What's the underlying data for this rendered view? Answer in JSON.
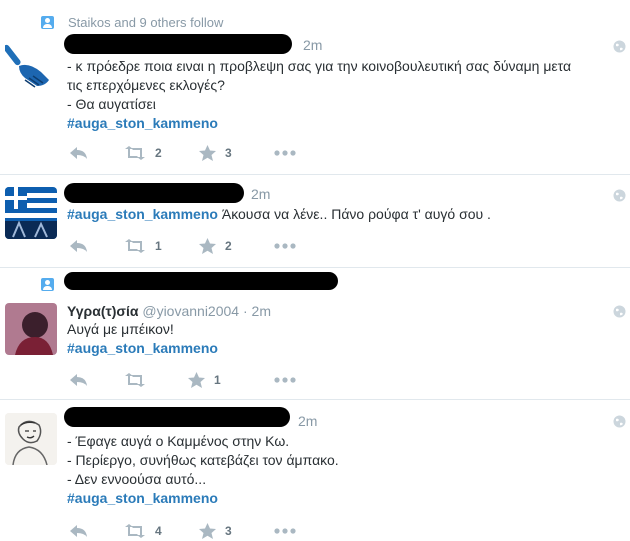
{
  "tweets": [
    {
      "context": "Staikos and 9 others follow",
      "time": "2m",
      "lines": [
        "- κ πρόεδρε ποια ειναι η προβλεψη σας για την κοινοβουλευτική σας δύναμη μετα",
        "τις επερχόμενες εκλογές?",
        "- Θα αυγατίσει"
      ],
      "hashtag": "#auga_ston_kammeno",
      "retweets": "2",
      "favorites": "3",
      "avatar_icon": "brush-icon"
    },
    {
      "time": "2m",
      "hashtag": "#auga_ston_kammeno",
      "after_hashtag": " Άκουσα να λένε.. Πάνο ρούφα τ' αυγό σου .",
      "retweets": "1",
      "favorites": "2",
      "avatar_icon": "greek-flag-icon"
    },
    {
      "fullname": "Υγρα(τ)σία",
      "handle": "@yiovanni2004",
      "sep": " · ",
      "time": "2m",
      "lines": [
        "Αυγά με μπέικον!"
      ],
      "hashtag": "#auga_ston_kammeno",
      "retweets": "",
      "favorites": "1",
      "avatar_icon": "profile-photo"
    },
    {
      "time": "2m",
      "lines": [
        "- Έφαγε αυγά ο Καμμένος στην Κω.",
        "- Περίεργο, συνήθως κατεβάζει τον άμπακο.",
        "- Δεν εννοούσα αυτό..."
      ],
      "hashtag": "#auga_ston_kammeno",
      "retweets": "4",
      "favorites": "3",
      "avatar_icon": "sketch-profile-photo"
    }
  ],
  "colors": {
    "hashtag": "#2b7bb9",
    "meta": "#8899a6",
    "text": "#292f33",
    "action": "#aab8c2",
    "context_icon": "#55acee"
  }
}
